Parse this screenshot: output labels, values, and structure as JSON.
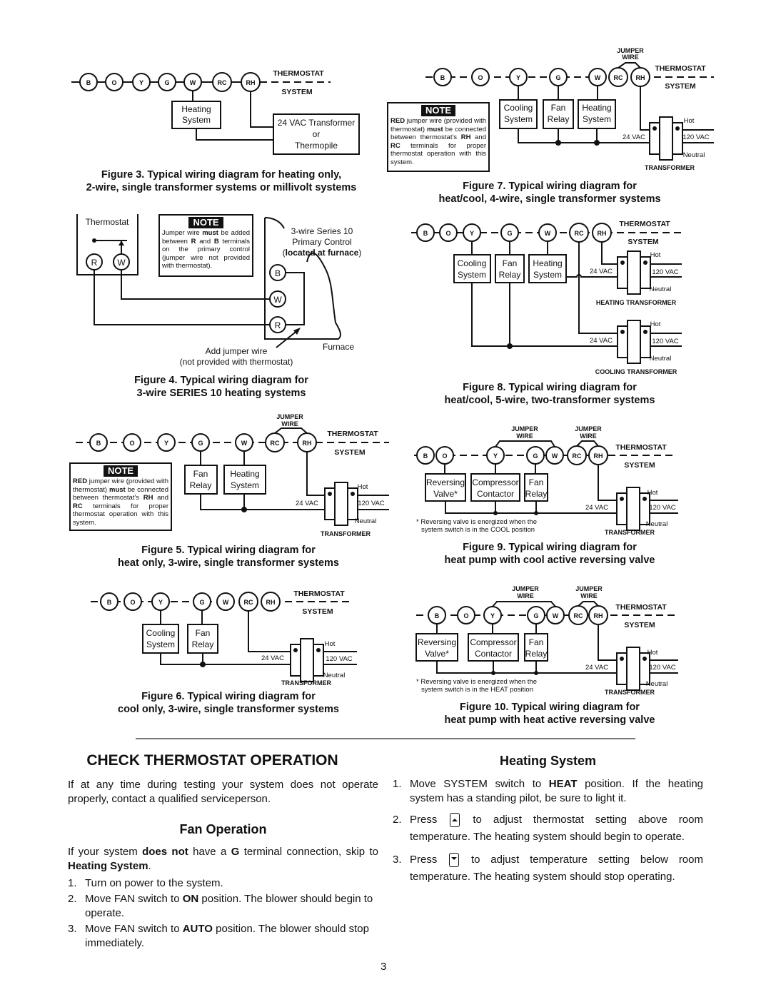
{
  "labels": {
    "thermostat": "THERMOSTAT",
    "system": "SYSTEM",
    "jumper": "JUMPER",
    "wire": "WIRE",
    "transformer": "TRANSFORMER",
    "hot": "Hot",
    "neutral": "Neutral",
    "vac24": "24 VAC",
    "vac120": "120 VAC",
    "heating_transformer": "HEATING TRANSFORMER",
    "cooling_transformer": "COOLING TRANSFORMER"
  },
  "terminals": {
    "B": "B",
    "O": "O",
    "Y": "Y",
    "G": "G",
    "W": "W",
    "RC": "RC",
    "RH": "RH",
    "R": "R"
  },
  "components": {
    "heating_1": "Heating",
    "heating_2": "System",
    "cooling_1": "Cooling",
    "cooling_2": "System",
    "fan_1": "Fan",
    "fan_2": "Relay",
    "reversing_1": "Reversing",
    "reversing_2": "Valve*",
    "compressor_1": "Compressor",
    "compressor_2": "Contactor",
    "tx24_1": "24 VAC Transformer",
    "tx24_2": "or",
    "tx24_3": "Thermopile"
  },
  "note": {
    "title": "NOTE",
    "red_jumper": {
      "p1": "RED",
      "p2": " jumper wire (provided with thermostat) ",
      "p3": "must",
      "p4": " be connected between thermostat's ",
      "p5": "RH",
      "p6": " and ",
      "p7": "RC",
      "p8": " terminals for proper thermostat operation with this system."
    },
    "series10": {
      "p1": "Jumper wire ",
      "p2": "must",
      "p3": " be added between ",
      "p4": "R",
      "p5": " and ",
      "p6": "B",
      "p7": " terminals on the primary control (jumper wire not provided with thermostat)."
    }
  },
  "fig4": {
    "thermostat": "Thermostat",
    "primary_1": "3-wire Series 10",
    "primary_2": "Primary Control",
    "primary_3a": "(",
    "primary_3b": "located at furnace",
    "primary_3c": ")",
    "furnace": "Furnace",
    "add_jumper_1": "Add jumper wire",
    "add_jumper_2": "(not provided with thermostat)"
  },
  "reversing_note": {
    "cool_1": "* Reversing valve is energized when the",
    "cool_2": "system switch is in the COOL position",
    "heat_1": "* Reversing valve is energized when the",
    "heat_2": "system switch is in the HEAT position"
  },
  "captions": {
    "fig3_1": "Figure 3. Typical wiring diagram for heating only,",
    "fig3_2": "2-wire, single transformer systems or millivolt systems",
    "fig4_1": "Figure 4. Typical wiring diagram for",
    "fig4_2": "3-wire SERIES 10 heating systems",
    "fig5_1": "Figure 5. Typical wiring diagram for",
    "fig5_2": "heat only,  3-wire, single transformer systems",
    "fig6_1": "Figure 6. Typical wiring diagram for",
    "fig6_2": "cool only, 3-wire, single transformer systems",
    "fig7_1": "Figure 7. Typical wiring diagram for",
    "fig7_2": "heat/cool, 4-wire, single transformer systems",
    "fig8_1": "Figure 8. Typical wiring diagram for",
    "fig8_2": "heat/cool, 5-wire, two-transformer systems",
    "fig9_1": "Figure 9. Typical wiring diagram for",
    "fig9_2": "heat pump with cool active reversing valve",
    "fig10_1": "Figure 10. Typical wiring diagram for",
    "fig10_2": "heat pump with heat active reversing valve"
  },
  "check": {
    "title": "CHECK THERMOSTAT OPERATION",
    "intro": "If at any time during testing your system does not operate properly, contact a qualified serviceperson."
  },
  "fan_operation": {
    "title": "Fan Operation",
    "intro": {
      "p1": "If your system ",
      "p2": "does not",
      "p3": " have a ",
      "p4": "G",
      "p5": " terminal connection, skip to ",
      "p6": "Heating System",
      "p7": "."
    },
    "steps": [
      {
        "num": "1.",
        "p1": "Turn on power to the system."
      },
      {
        "num": "2.",
        "p1": "Move FAN switch to ",
        "p2": "ON",
        "p3": " position. The blower should begin to operate."
      },
      {
        "num": "3.",
        "p1": "Move FAN switch to ",
        "p2": "AUTO",
        "p3": " position. The blower should stop immediately."
      }
    ]
  },
  "heating_system": {
    "title": "Heating System",
    "steps": [
      {
        "num": "1.",
        "p1": "Move SYSTEM switch to ",
        "p2": "HEAT",
        "p3": " position. If the heating system has a standing pilot, be sure to light it."
      },
      {
        "num": "2.",
        "p1": "Press ",
        "icon": "up-arrow-button-icon",
        "p3": " to adjust thermostat setting above room temperature. The heating system should begin to operate."
      },
      {
        "num": "3.",
        "p1": "Press ",
        "icon": "down-arrow-button-icon",
        "p3": " to adjust temperature setting below room temperature. The heating system should stop operating."
      }
    ]
  },
  "page_number": "3"
}
